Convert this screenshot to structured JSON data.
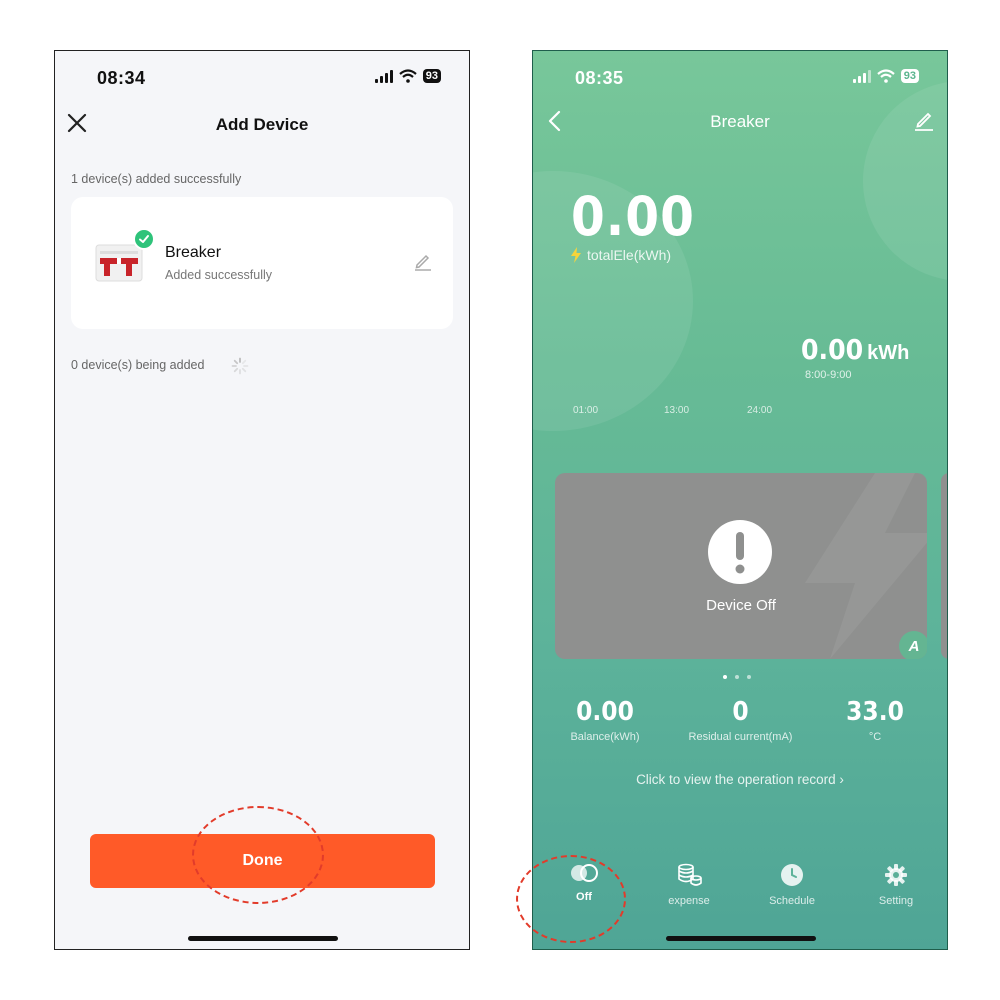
{
  "left": {
    "status": {
      "time": "08:34",
      "battery": "93"
    },
    "header": {
      "title": "Add Device"
    },
    "added_summary": "1 device(s) added successfully",
    "device": {
      "name": "Breaker",
      "status": "Added successfully"
    },
    "pending_summary": "0 device(s) being added",
    "done_label": "Done"
  },
  "right": {
    "status": {
      "time": "08:35",
      "battery": "93"
    },
    "header": {
      "title": "Breaker"
    },
    "total": {
      "value": "0.00",
      "label": "totalEle(kWh)"
    },
    "period": {
      "value": "0.00",
      "unit": "kWh",
      "range": "8:00-9:00"
    },
    "axis_ticks": [
      "01:00",
      "13:00",
      "24:00"
    ],
    "card": {
      "status": "Device Off",
      "badge": "A"
    },
    "stats": [
      {
        "value": "0.00",
        "label": "Balance(kWh)"
      },
      {
        "value": "0",
        "label": "Residual current(mA)"
      },
      {
        "value": "33.0",
        "label": "°C"
      }
    ],
    "operation_record": "Click to view the operation record",
    "tabs": [
      {
        "label": "Off",
        "icon": "toggle-icon"
      },
      {
        "label": "expense",
        "icon": "coins-icon"
      },
      {
        "label": "Schedule",
        "icon": "clock-icon"
      },
      {
        "label": "Setting",
        "icon": "gear-icon"
      }
    ]
  },
  "colors": {
    "accent_orange": "#ff5a28",
    "success_green": "#2ec37a",
    "panel_green": "#5db39a",
    "annotation_red": "#e23b2a"
  }
}
